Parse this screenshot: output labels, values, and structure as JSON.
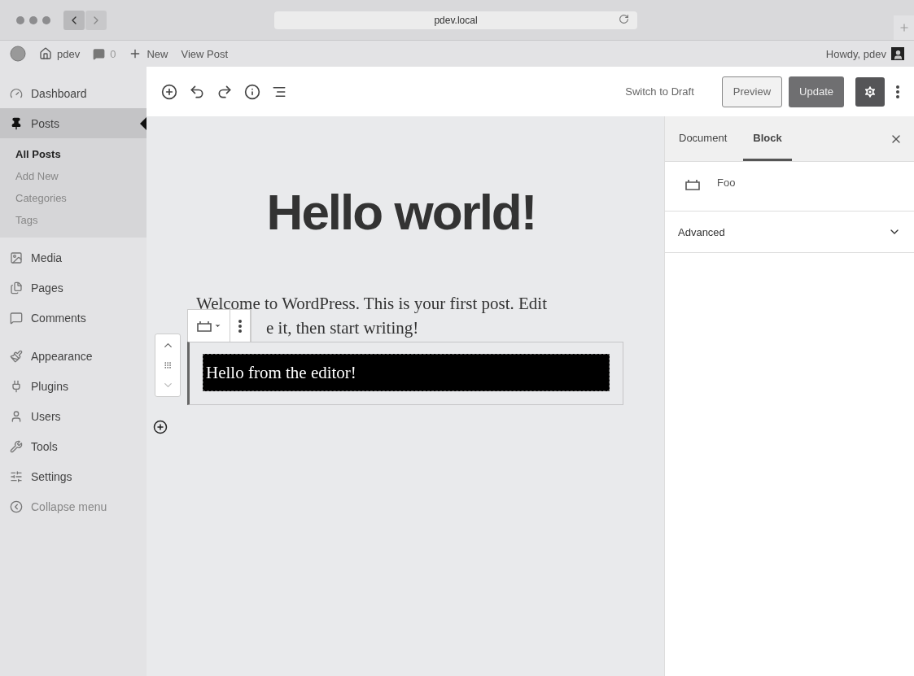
{
  "browser": {
    "address": "pdev.local"
  },
  "admin_bar": {
    "site": "pdev",
    "comments": "0",
    "new": "New",
    "view_post": "View Post",
    "greeting": "Howdy, pdev"
  },
  "sidebar": {
    "items": [
      {
        "label": "Dashboard",
        "selected": false
      },
      {
        "label": "Posts",
        "selected": true,
        "children": [
          {
            "label": "All Posts",
            "selected": true
          },
          {
            "label": "Add New",
            "selected": false
          },
          {
            "label": "Categories",
            "selected": false
          },
          {
            "label": "Tags",
            "selected": false
          }
        ]
      },
      {
        "label": "Media",
        "selected": false
      },
      {
        "label": "Pages",
        "selected": false
      },
      {
        "label": "Comments",
        "selected": false
      },
      {
        "label": "Appearance",
        "selected": false
      },
      {
        "label": "Plugins",
        "selected": false
      },
      {
        "label": "Users",
        "selected": false
      },
      {
        "label": "Tools",
        "selected": false
      },
      {
        "label": "Settings",
        "selected": false
      }
    ],
    "collapse": "Collapse menu"
  },
  "toolbar": {
    "switch_to_draft": "Switch to Draft",
    "preview": "Preview",
    "update": "Update",
    "settings_on": true
  },
  "editor": {
    "title": "Hello world!",
    "paragraph_lines": [
      "Welcome to WordPress. This is your first post. Edit",
      "e it, then start writing!"
    ],
    "block_text": "Hello from the editor!"
  },
  "panel": {
    "tabs": [
      {
        "label": "Document",
        "selected": false
      },
      {
        "label": "Block",
        "selected": true
      }
    ],
    "block_name": "Foo",
    "section": {
      "label": "Advanced",
      "expanded": false
    }
  }
}
